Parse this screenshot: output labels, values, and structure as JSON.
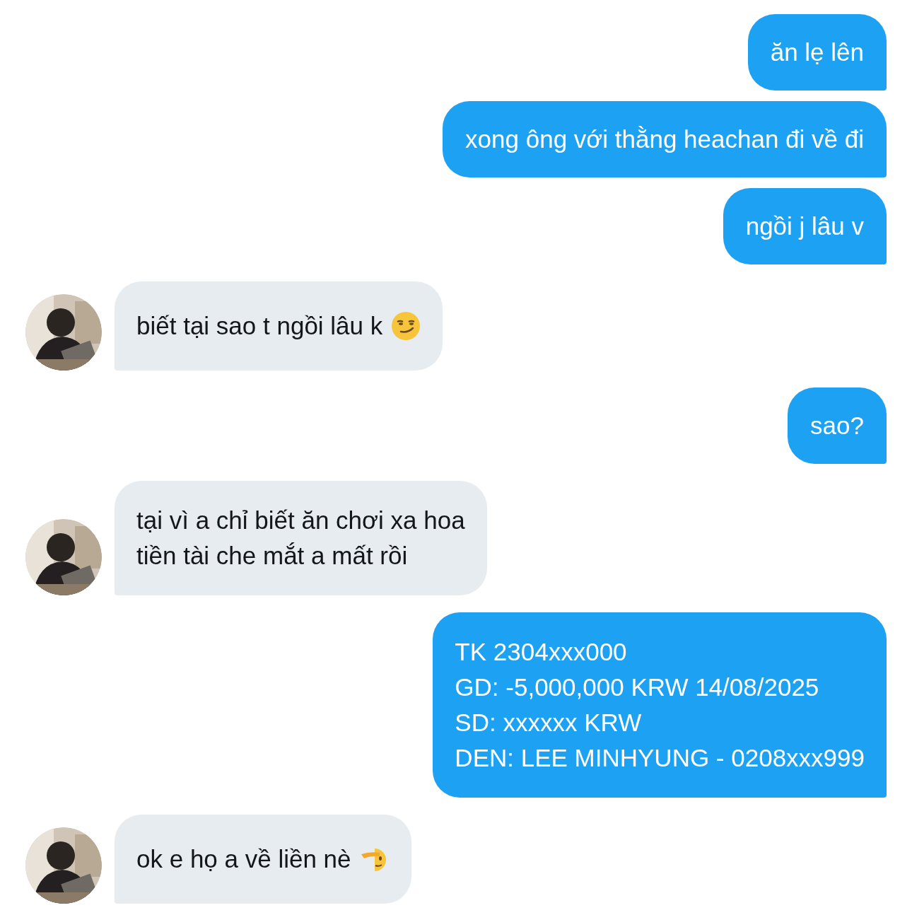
{
  "messages": [
    {
      "outgoing": true,
      "lines": [
        "ăn lẹ lên"
      ]
    },
    {
      "outgoing": true,
      "lines": [
        "xong ông với thằng heachan đi về đi"
      ]
    },
    {
      "outgoing": true,
      "lines": [
        "ngồi j lâu v"
      ]
    },
    {
      "outgoing": false,
      "lines": [
        "biết tại sao t ngồi lâu k"
      ],
      "trailing_emoji": {
        "kind": "smirk"
      }
    },
    {
      "outgoing": true,
      "lines": [
        "sao?"
      ]
    },
    {
      "outgoing": false,
      "lines": [
        "tại vì a chỉ biết ăn chơi xa hoa",
        "tiền tài che mắt a mất rồi"
      ]
    },
    {
      "outgoing": true,
      "lines": [
        "TK 2304xxx000",
        "GD: -5,000,000 KRW 14/08/2025",
        "SD: xxxxxx KRW",
        "DEN: LEE MINHYUNG - 0208xxx999"
      ]
    },
    {
      "outgoing": false,
      "lines": [
        "ok e họ a về liền nè"
      ],
      "trailing_emoji": {
        "kind": "salute"
      }
    }
  ]
}
